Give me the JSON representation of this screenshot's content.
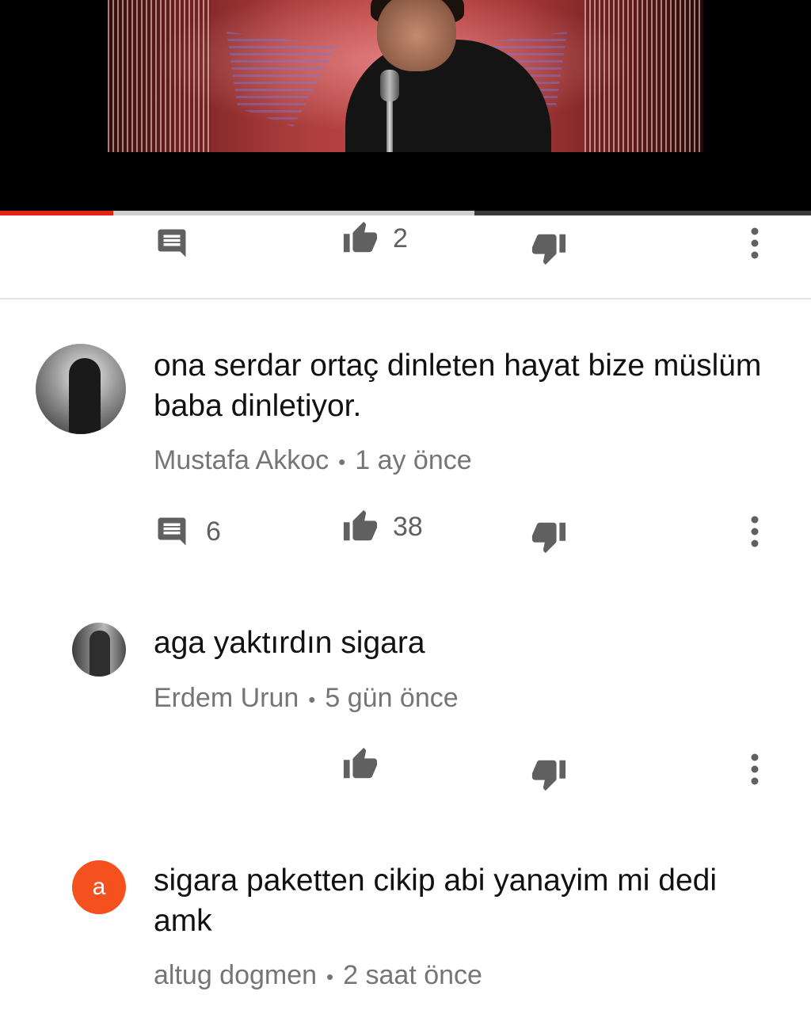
{
  "video": {
    "progress": {
      "played_fraction": 0.14,
      "buffered_fraction": 0.585
    }
  },
  "top_action_bar": {
    "reply_icon": "comment-icon",
    "like_icon": "thumb-up-icon",
    "like_count": "2",
    "dislike_icon": "thumb-down-icon",
    "more_icon": "more-vert-icon"
  },
  "comments": [
    {
      "text": "ona serdar ortaç dinleten hayat bize müslüm baba dinletiyor.",
      "author": "Mustafa Akkoc",
      "time": "1 ay önce",
      "separator": "•",
      "reply_count": "6",
      "like_count": "38"
    },
    {
      "text": "aga yaktırdın sigara",
      "author": "Erdem Urun",
      "time": "5 gün önce",
      "separator": "•"
    },
    {
      "text": "sigara paketten cikip abi yanayim mi dedi amk",
      "author": "altug dogmen",
      "time": "2 saat önce",
      "separator": "•",
      "avatar_letter": "a"
    }
  ],
  "colors": {
    "progress_played": "#e62117",
    "icon": "#606060",
    "meta_text": "#757575",
    "letter_avatar": "#f4511e"
  }
}
